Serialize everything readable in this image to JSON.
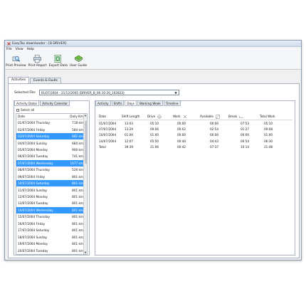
{
  "window": {
    "title": "EasyTac downloader - [8 DRIVER]"
  },
  "menu": [
    "File",
    "View",
    "Help"
  ],
  "toolbar": [
    {
      "label": "Print Preview",
      "icon": "print-preview-icon"
    },
    {
      "label": "Print Report",
      "icon": "print-report-icon"
    },
    {
      "label": "Export Data",
      "icon": "export-data-icon"
    },
    {
      "label": "User Guide",
      "icon": "user-guide-icon"
    }
  ],
  "main_tabs": [
    "Activities",
    "Events & Faults"
  ],
  "selected_file": {
    "label": "Selected File:",
    "value": "01/07/2004 - 21/12/2005 (DRIVER_B_06-10-20_102823)"
  },
  "left_tabs": [
    "Activity Dates",
    "Activity Calendar"
  ],
  "select_all_label": "Select all",
  "date_list": {
    "headers": {
      "date": "Date",
      "km": "Daily Km"
    },
    "rows": [
      {
        "date": "01/07/2004 Thursday",
        "km": "718 km",
        "selected": false
      },
      {
        "date": "02/07/2004 Friday",
        "km": "584 km",
        "selected": false
      },
      {
        "date": "03/07/2004 Saturday",
        "km": "882 km",
        "selected": true
      },
      {
        "date": "04/07/2004 Sunday",
        "km": "684 km",
        "selected": false
      },
      {
        "date": "05/07/2004 Monday",
        "km": "900 km",
        "selected": false
      },
      {
        "date": "06/07/2004 Tuesday",
        "km": "741 km",
        "selected": false
      },
      {
        "date": "07/07/2004 Wednesday",
        "km": "1077 km",
        "selected": true
      },
      {
        "date": "08/07/2004 Thursday",
        "km": "526 km",
        "selected": false
      },
      {
        "date": "09/07/2004 Friday",
        "km": "801 km",
        "selected": false
      },
      {
        "date": "10/07/2004 Saturday",
        "km": "801 km",
        "selected": true
      },
      {
        "date": "11/07/2004 Sunday",
        "km": "801 km",
        "selected": false
      },
      {
        "date": "12/07/2004 Monday",
        "km": "801 km",
        "selected": false
      },
      {
        "date": "13/07/2004 Tuesday",
        "km": "801 km",
        "selected": false
      },
      {
        "date": "14/07/2004 Wednesday",
        "km": "801 km",
        "selected": true
      },
      {
        "date": "15/07/2004 Thursday",
        "km": "801 km",
        "selected": false
      },
      {
        "date": "16/07/2004 Friday",
        "km": "801 km",
        "selected": false
      },
      {
        "date": "17/07/2004 Saturday",
        "km": "801 km",
        "selected": false
      },
      {
        "date": "18/07/2004 Sunday",
        "km": "801 km",
        "selected": false
      },
      {
        "date": "19/07/2004 Monday",
        "km": "801 km",
        "selected": false
      },
      {
        "date": "20/07/2004 Tuesday",
        "km": "801 km",
        "selected": false
      }
    ]
  },
  "right_tabs": [
    "Activity",
    "Shifts",
    "Days",
    "Working Week",
    "Timeline"
  ],
  "days_table": {
    "headers": {
      "date": "Date",
      "shift": "Shift Length",
      "drive": "Drive",
      "work": "Work",
      "available": "Available",
      "break": "Break",
      "total": "Total Work"
    },
    "rows": [
      {
        "date": "01/07/2004",
        "shift": "13:03",
        "drive": "05:10",
        "work": "00:00",
        "available": "00:00",
        "break": "07:53",
        "total": "05:10"
      },
      {
        "date": "07/07/2004",
        "shift": "13:29",
        "drive": "09:06",
        "work": "00:02",
        "available": "02:54",
        "break": "01:27",
        "total": "09:08"
      },
      {
        "date": "10/07/2004",
        "shift": "01:00",
        "drive": "01:00",
        "work": "00:00",
        "available": "00:00",
        "break": "00:00",
        "total": "01:00"
      },
      {
        "date": "14/07/2004",
        "shift": "12:07",
        "drive": "05:50",
        "work": "00:40",
        "available": "04:43",
        "break": "00:54",
        "total": "06:30"
      },
      {
        "date": "Total",
        "shift": "39:39",
        "drive": "21:06",
        "work": "00:42",
        "available": "07:37",
        "break": "10:14",
        "total": "21:48"
      }
    ]
  },
  "colors": {
    "selection": "#3399ff",
    "titlebar": "#dce6f2"
  }
}
